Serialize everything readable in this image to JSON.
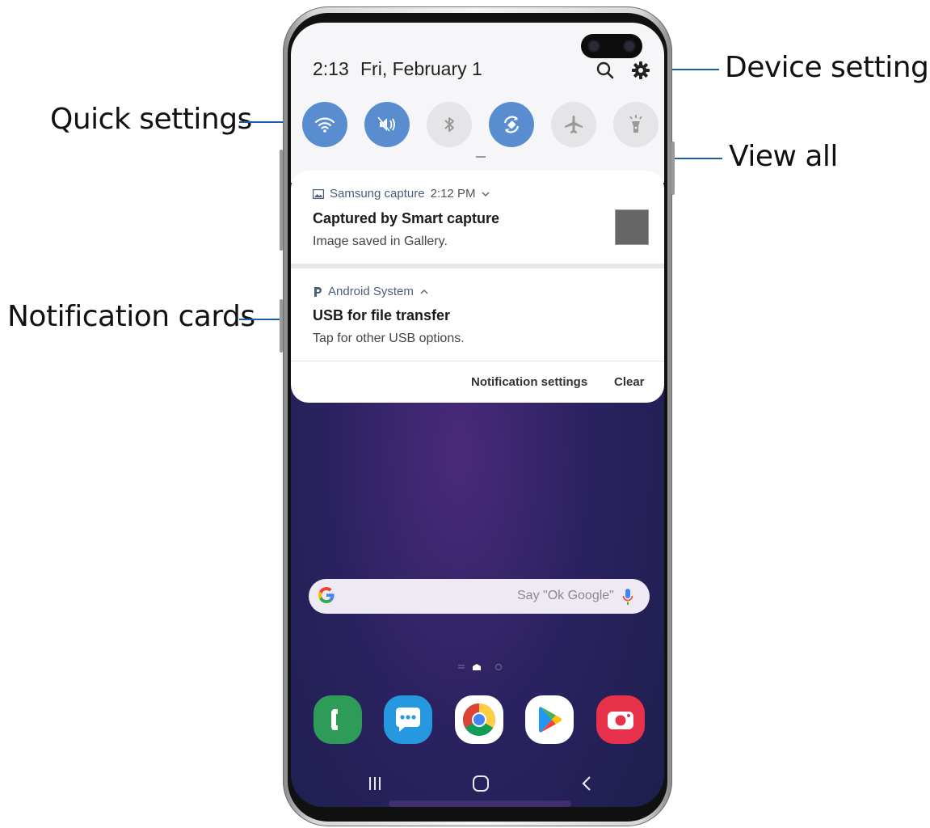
{
  "callouts": {
    "quick_settings": "Quick settings",
    "device_settings": "Device settings",
    "view_all": "View all",
    "notification_cards": "Notification cards"
  },
  "status": {
    "time": "2:13",
    "date": "Fri, February 1"
  },
  "quick_settings": [
    {
      "name": "wifi",
      "state": "on"
    },
    {
      "name": "sound-mute",
      "state": "on"
    },
    {
      "name": "bluetooth",
      "state": "off"
    },
    {
      "name": "auto-rotate",
      "state": "on"
    },
    {
      "name": "airplane-mode",
      "state": "off"
    },
    {
      "name": "flashlight",
      "state": "off"
    }
  ],
  "notifications": [
    {
      "app": "Samsung capture",
      "time": "2:12 PM",
      "title": "Captured by Smart capture",
      "body": "Image saved in Gallery."
    },
    {
      "app": "Android System",
      "title": "USB for file transfer",
      "body": "Tap for other USB options.",
      "actions": {
        "settings": "Notification settings",
        "clear": "Clear"
      }
    }
  ],
  "search": {
    "hint": "Say \"Ok Google\""
  },
  "dock": [
    "phone",
    "messages",
    "chrome",
    "play-store",
    "camera"
  ],
  "colors": {
    "accent": "#5a8dd0",
    "callout_line": "#1a5fa3"
  }
}
